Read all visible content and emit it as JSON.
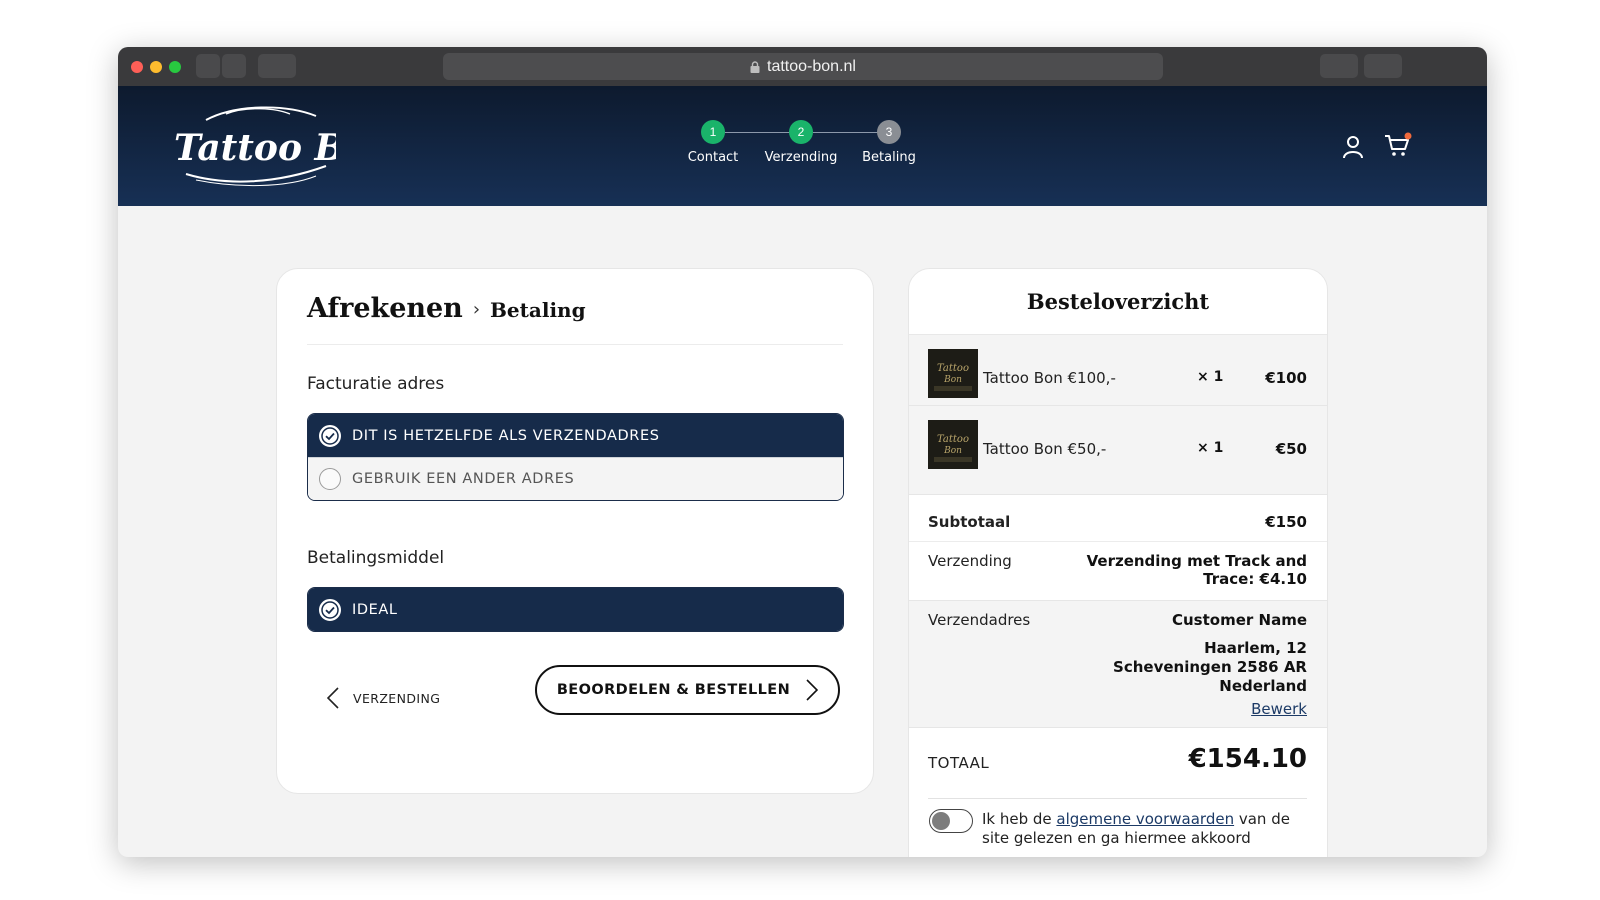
{
  "browser": {
    "url": "tattoo-bon.nl"
  },
  "header": {
    "logo_text": "Tattoo Bon",
    "steps": [
      {
        "number": "1",
        "label": "Contact",
        "state": "done"
      },
      {
        "number": "2",
        "label": "Verzending",
        "state": "done"
      },
      {
        "number": "3",
        "label": "Betaling",
        "state": "current"
      }
    ],
    "icons": [
      "account-icon",
      "cart-icon"
    ],
    "cart_badge_color": "#f06a3c"
  },
  "checkout": {
    "breadcrumb_main": "Afrekenen",
    "breadcrumb_sep": "›",
    "breadcrumb_current": "Betaling",
    "billing_title": "Facturatie adres",
    "billing_options": [
      {
        "label": "DIT IS HETZELFDE ALS VERZENDADRES",
        "selected": true
      },
      {
        "label": "GEBRUIK EEN ANDER ADRES",
        "selected": false
      }
    ],
    "payment_title": "Betalingsmiddel",
    "payment_options": [
      {
        "label": "IDEAL",
        "selected": true
      }
    ],
    "back_label": "VERZENDING",
    "submit_label": "BEOORDELEN & BESTELLEN"
  },
  "summary": {
    "title": "Besteloverzicht",
    "items": [
      {
        "name": "Tattoo Bon €100,-",
        "qty": "× 1",
        "price": "€100"
      },
      {
        "name": "Tattoo Bon €50,-",
        "qty": "× 1",
        "price": "€50"
      }
    ],
    "subtotal_label": "Subtotaal",
    "subtotal_value": "€150",
    "shipping_label": "Verzending",
    "shipping_value_line1": "Verzending met Track and",
    "shipping_value_line2": "Trace: €4.10",
    "address_label": "Verzendadres",
    "address_name": "Customer Name",
    "address_line1": "Haarlem, 12",
    "address_line2": "Scheveningen 2586 AR",
    "address_line3": "Nederland",
    "edit_label": "Bewerk",
    "total_label": "TOTAAL",
    "total_value": "€154.10",
    "terms_prefix": "Ik heb de ",
    "terms_link": "algemene voorwaarden",
    "terms_suffix": " van de site gelezen en ga hiermee akkoord"
  },
  "colors": {
    "navy": "#162b4a",
    "step_done": "#1ab36a",
    "step_todo": "#8a8e94"
  }
}
